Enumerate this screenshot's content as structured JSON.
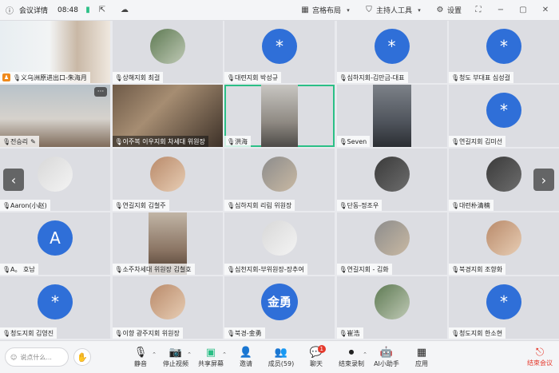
{
  "titlebar": {
    "meeting_details": "会议详情",
    "time": "08:48",
    "layout_label": "宫格布局",
    "host_tools_label": "主持人工具",
    "settings_label": "设置"
  },
  "participants": [
    {
      "name": "义乌洲原进出口-朱海月",
      "type": "video",
      "host": true
    },
    {
      "name": "상해지회 최걸",
      "type": "avatar"
    },
    {
      "name": "대련지회 박성규",
      "type": "avatar",
      "initials": "*"
    },
    {
      "name": "심하지회-김만금-대표",
      "type": "avatar",
      "initials": "*"
    },
    {
      "name": "청도 부대표 심성걸",
      "type": "avatar",
      "initials": "*"
    },
    {
      "name": "전승리",
      "type": "video"
    },
    {
      "name": "이주복 이우지회 차세대 위원장",
      "type": "video"
    },
    {
      "name": "洪海",
      "type": "video",
      "active": true
    },
    {
      "name": "Seven",
      "type": "video"
    },
    {
      "name": "연길지회 김미선",
      "type": "avatar",
      "initials": "*"
    },
    {
      "name": "Aaron(小赵)",
      "type": "avatar"
    },
    {
      "name": "연길지회 김철주",
      "type": "avatar"
    },
    {
      "name": "심하지회 리림 위원장",
      "type": "avatar"
    },
    {
      "name": "단동-정조우",
      "type": "avatar"
    },
    {
      "name": "대련朴清楠",
      "type": "avatar"
    },
    {
      "name": "A。 호남",
      "type": "avatar",
      "initials": "A"
    },
    {
      "name": "소주차세대 위원장 김철호",
      "type": "video"
    },
    {
      "name": "심천지회-부위원장-장추여",
      "type": "avatar"
    },
    {
      "name": "연길지회 - 김화",
      "type": "avatar"
    },
    {
      "name": "북경지회 조향화",
      "type": "avatar"
    },
    {
      "name": "청도지회 김영진",
      "type": "avatar",
      "initials": "*"
    },
    {
      "name": "이향 광주지회 위원장",
      "type": "avatar"
    },
    {
      "name": "북경-金勇",
      "type": "avatar",
      "initials": "金勇"
    },
    {
      "name": "崔浩",
      "type": "avatar"
    },
    {
      "name": "청도지회 한소현",
      "type": "avatar",
      "initials": "*"
    }
  ],
  "toolbar": {
    "chat_placeholder": "说点什么...",
    "mute": "静音",
    "stop_video": "停止视频",
    "share_screen": "共享屏幕",
    "invite": "邀请",
    "members": "成员(59)",
    "chat": "聊天",
    "chat_badge": "1",
    "record": "结束录制",
    "ai_assistant": "AI小助手",
    "apps": "应用",
    "end_meeting": "结束会议"
  },
  "colors": {
    "accent_blue": "#2f6fd8",
    "active_border": "#2bbf86",
    "end_red": "#e5392c",
    "host_orange": "#f08a1c"
  }
}
